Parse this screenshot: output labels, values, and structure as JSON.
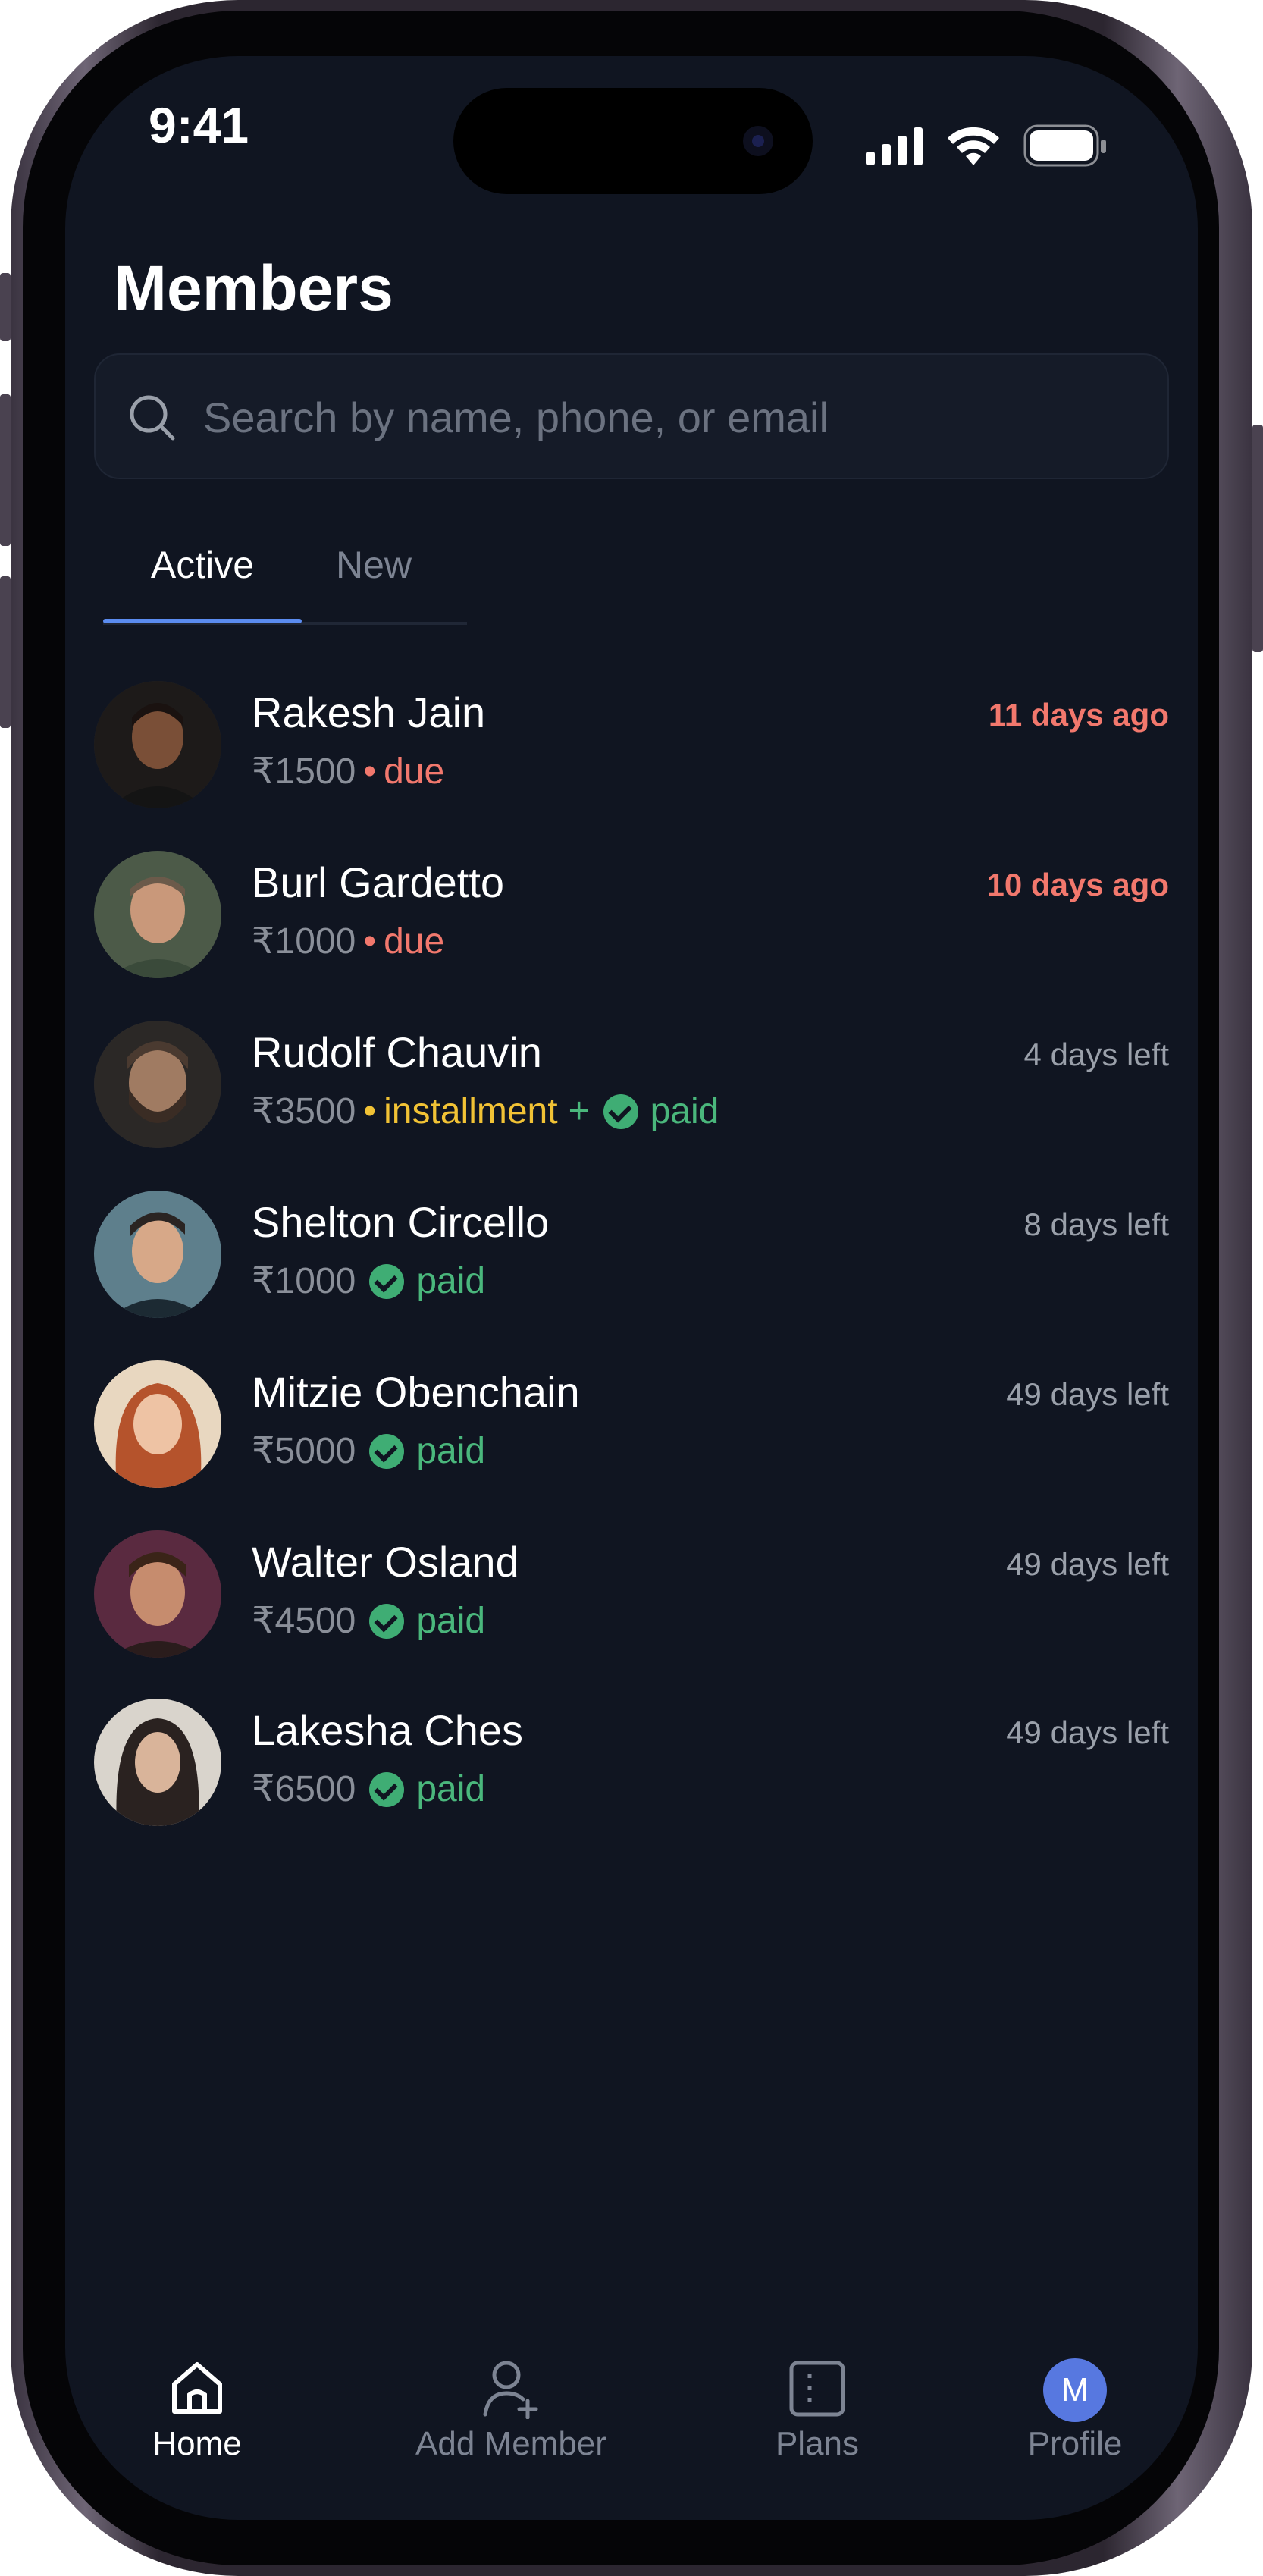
{
  "status_bar": {
    "time": "9:41"
  },
  "header": {
    "title": "Members"
  },
  "search": {
    "placeholder": "Search by name, phone, or email",
    "value": ""
  },
  "tabs": [
    {
      "label": "Active",
      "selected": true
    },
    {
      "label": "New",
      "selected": false
    }
  ],
  "members": [
    {
      "name": "Rakesh Jain",
      "amount": "₹1500",
      "status": "due",
      "right": "11 days ago",
      "overdue": true
    },
    {
      "name": "Burl Gardetto",
      "amount": "₹1000",
      "status": "due",
      "right": "10 days ago",
      "overdue": true
    },
    {
      "name": "Rudolf Chauvin",
      "amount": "₹3500",
      "status": "installment",
      "plus": "+",
      "status2": "paid",
      "right": "4 days left",
      "overdue": false
    },
    {
      "name": "Shelton Circello",
      "amount": "₹1000",
      "status": "paid",
      "right": "8 days left",
      "overdue": false
    },
    {
      "name": "Mitzie Obenchain",
      "amount": "₹5000",
      "status": "paid",
      "right": "49 days left",
      "overdue": false
    },
    {
      "name": "Walter Osland",
      "amount": "₹4500",
      "status": "paid",
      "right": "49 days left",
      "overdue": false
    },
    {
      "name": "Lakesha Ches",
      "amount": "₹6500",
      "status": "paid",
      "right": "49 days left",
      "overdue": false
    }
  ],
  "bottom_nav": {
    "home": "Home",
    "add_member": "Add Member",
    "plans": "Plans",
    "profile": "Profile",
    "profile_initial": "M",
    "active": "Home"
  },
  "colors": {
    "background": "#101521",
    "accent": "#5b8cf0",
    "due": "#f2786d",
    "installment": "#f1c235",
    "paid": "#4ab77c",
    "muted": "#8a8f99"
  },
  "dot": "•"
}
